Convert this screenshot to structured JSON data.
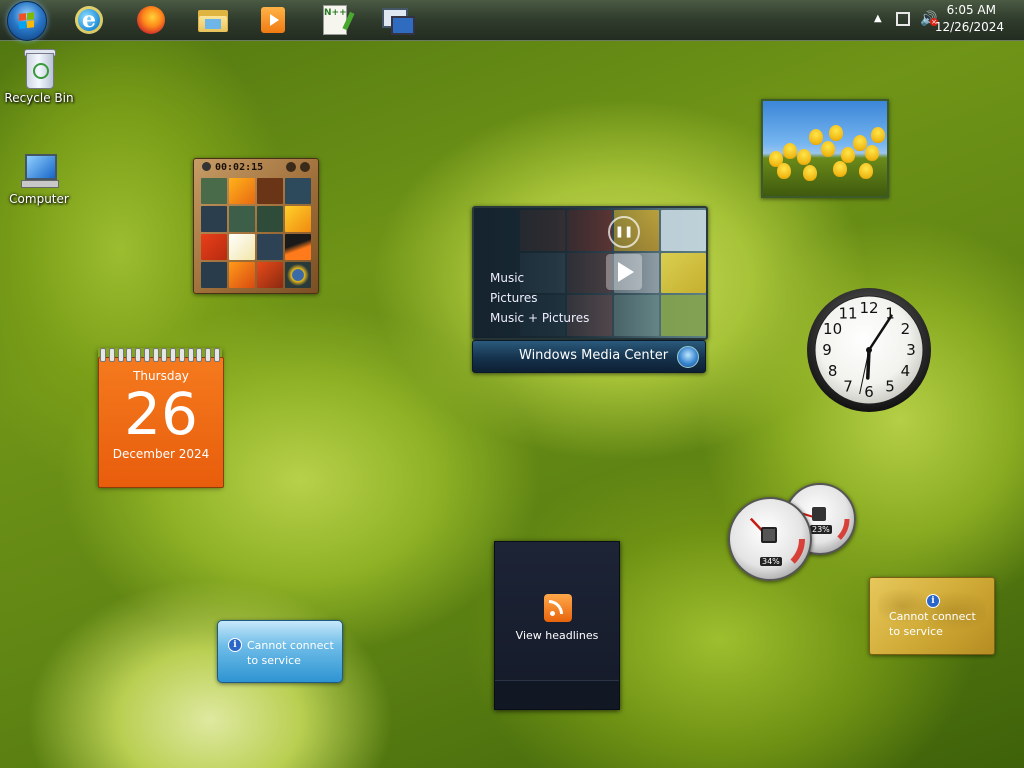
{
  "taskbar": {
    "pinned": [
      {
        "name": "start-orb"
      },
      {
        "name": "internet-explorer-icon"
      },
      {
        "name": "firefox-icon"
      },
      {
        "name": "windows-explorer-icon"
      },
      {
        "name": "windows-media-player-icon"
      },
      {
        "name": "notepad-plus-plus-icon"
      },
      {
        "name": "remote-desktop-icon"
      }
    ],
    "npp_glyph": "N++"
  },
  "tray": {
    "time": "6:05 AM",
    "date": "12/26/2024",
    "volume_muted_glyph": "×"
  },
  "desktop_icons": {
    "recycle_bin": "Recycle Bin",
    "computer": "Computer"
  },
  "gadgets": {
    "picture_puzzle": {
      "timer": "00:02:15"
    },
    "media_center": {
      "items": [
        "Music",
        "Pictures",
        "Music + Pictures"
      ],
      "title": "Windows Media Center"
    },
    "calendar": {
      "weekday": "Thursday",
      "day": "26",
      "month_year": "December 2024"
    },
    "clock": {
      "hour": 6,
      "minute": 5,
      "second": 32
    },
    "cpu_meter": {
      "cpu_percent": 34,
      "memory_percent": 23,
      "cpu_label": "34%",
      "memory_label": "23%"
    },
    "feed_headlines": {
      "label": "View headlines"
    },
    "weather": {
      "line1": "Cannot connect",
      "line2": "to service",
      "info": "i"
    },
    "currency": {
      "line1": "Cannot connect",
      "line2": "to service",
      "info": "i"
    }
  },
  "colors": {
    "calendar_orange": "#e85d0c",
    "accent_blue": "#2a78c8"
  }
}
